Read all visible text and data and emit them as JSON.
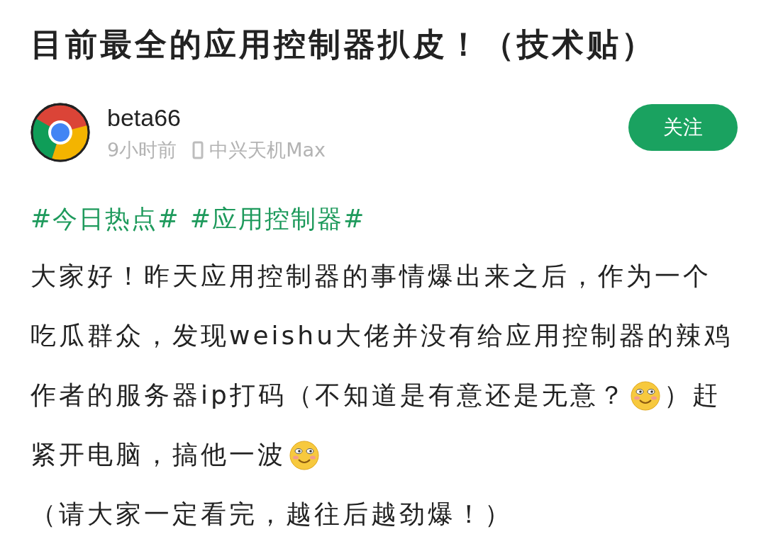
{
  "post": {
    "title": "目前最全的应用控制器扒皮！（技术贴）"
  },
  "author": {
    "name": "beta66",
    "time": "9小时前",
    "device": "中兴天机Max",
    "follow_button": "关注"
  },
  "tags": [
    "#今日热点#",
    "#应用控制器#"
  ],
  "body_lines": [
    [
      {
        "kind": "text",
        "text": "大家好！昨天应用控制器的事情爆出来之后，作为一个"
      }
    ],
    [
      {
        "kind": "text",
        "text": "吃瓜群众，发现weishu大佬并没有给应用控制器的辣鸡"
      }
    ],
    [
      {
        "kind": "text",
        "text": "作者的服务器ip打码（不知道是有意还是无意？"
      },
      {
        "kind": "emoji"
      },
      {
        "kind": "text",
        "text": "）赶"
      }
    ],
    [
      {
        "kind": "text",
        "text": "紧开电脑，搞他一波"
      },
      {
        "kind": "emoji"
      }
    ],
    [
      {
        "kind": "text",
        "text": "（请大家一定看完，越往后越劲爆！）"
      }
    ]
  ]
}
